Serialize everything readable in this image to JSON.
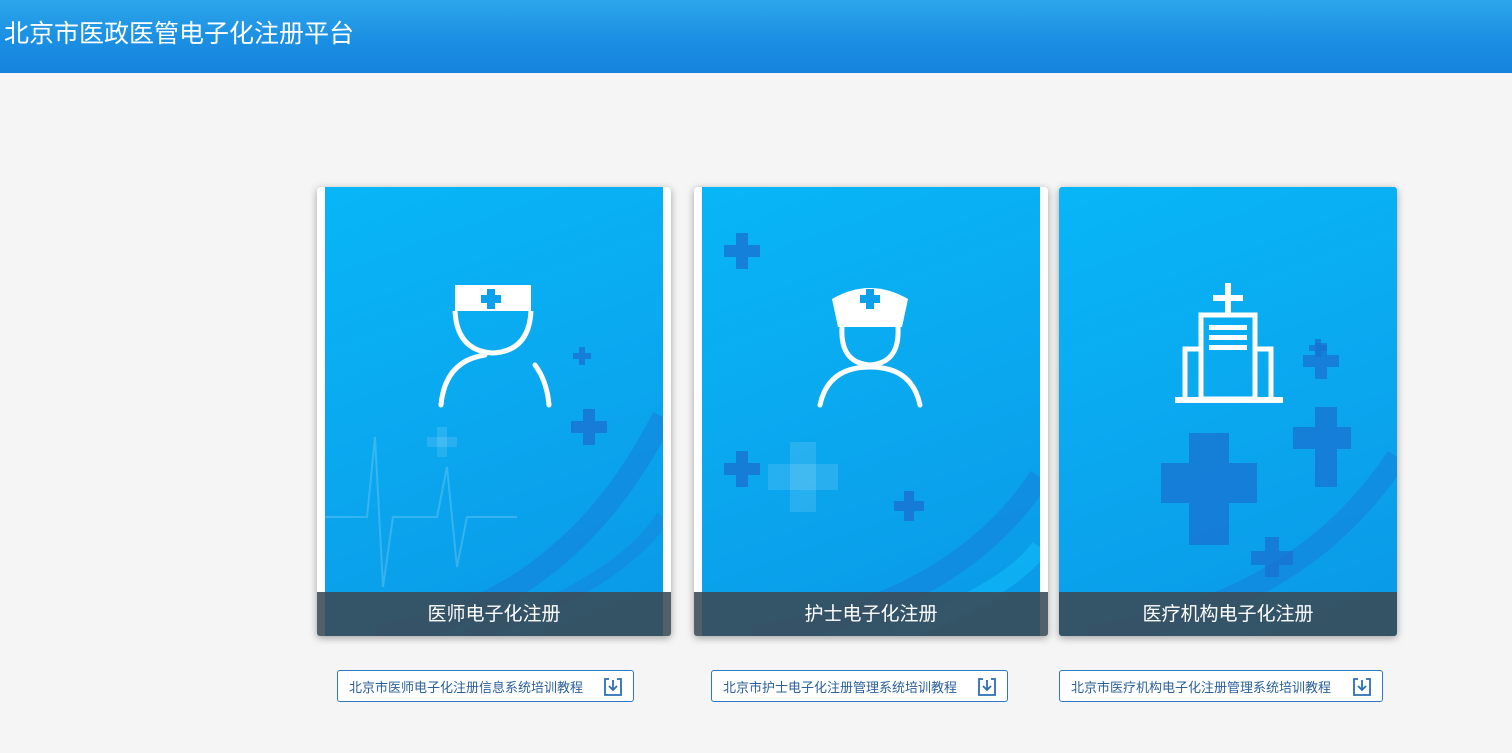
{
  "header": {
    "title": "北京市医政医管电子化注册平台"
  },
  "cards": [
    {
      "label": "医师电子化注册",
      "icon": "doctor-icon"
    },
    {
      "label": "护士电子化注册",
      "icon": "nurse-icon"
    },
    {
      "label": "医疗机构电子化注册",
      "icon": "hospital-building-icon"
    }
  ],
  "downloads": [
    {
      "label": "北京市医师电子化注册信息系统培训教程",
      "icon": "download-icon"
    },
    {
      "label": "北京市护士电子化注册管理系统培训教程",
      "icon": "download-icon"
    },
    {
      "label": "北京市医疗机构电子化注册管理系统培训教程",
      "icon": "download-icon"
    }
  ],
  "colors": {
    "header": "#1b8fe3",
    "card_blue": "#0aa9f0",
    "caption_bg": "#3a4a54",
    "link_border": "#2b78c8"
  }
}
